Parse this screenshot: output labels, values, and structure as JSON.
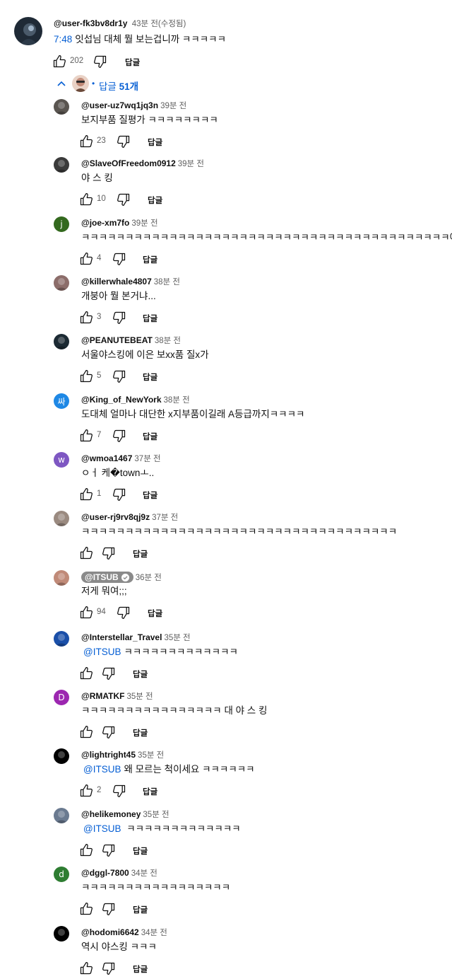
{
  "top_comment": {
    "author": "@user-fk3bv8dr1y",
    "time": "43분 전(수정됨)",
    "timestamp_link": "7:48",
    "text": "잇섭님 대체 뭘 보는겁니까 ㅋㅋㅋㅋㅋ",
    "likes": "202",
    "reply_label": "답글"
  },
  "replies_toggle": {
    "dot": "•",
    "label": "답글",
    "count": "51개"
  },
  "replies": [
    {
      "author": "@user-uz7wq1jq3n",
      "time": "39분 전",
      "mention": "",
      "text": "보지부품 질평가 ㅋㅋㅋㅋㅋㅋㅋㅋ",
      "likes": "23",
      "reply_label": "답글",
      "avatar": {
        "kind": "photo",
        "color": "#5a5550"
      }
    },
    {
      "author": "@SlaveOfFreedom0912",
      "time": "39분 전",
      "mention": "",
      "text": "야 스 킹",
      "likes": "10",
      "reply_label": "답글",
      "avatar": {
        "kind": "photo",
        "color": "#3a3a3a"
      }
    },
    {
      "author": "@joe-xm7fo",
      "time": "39분 전",
      "mention": "",
      "text": "ㅋㅋㅋㅋㅋㅋㅋㅋㅋㅋㅋㅋㅋㅋㅋㅋㅋㅋㅋㅋㅋㅋㅋㅋㅋㅋㅋㅋㅋㅋㅋㅋㅋㅋㅋㅋㅋㅋㅋㅋㅋㅋ아이",
      "likes": "4",
      "reply_label": "답글",
      "avatar": {
        "kind": "letter",
        "letter": "j",
        "color": "#33691e"
      }
    },
    {
      "author": "@killerwhale4807",
      "time": "38분 전",
      "mention": "",
      "text": "개붕아 뭘 본거냐...",
      "likes": "3",
      "reply_label": "답글",
      "avatar": {
        "kind": "photo",
        "color": "#8c6d6a"
      }
    },
    {
      "author": "@PEANUTEBEAT",
      "time": "38분 전",
      "mention": "",
      "text": "서울야스킹에 이은 보xx품 질x가",
      "likes": "5",
      "reply_label": "답글",
      "avatar": {
        "kind": "photo",
        "color": "#1c2a33"
      }
    },
    {
      "author": "@King_of_NewYork",
      "time": "38분 전",
      "mention": "",
      "text": "도대체 얼마나 대단한 x지부품이길래 A등급까지ㅋㅋㅋㅋ",
      "likes": "7",
      "reply_label": "답글",
      "avatar": {
        "kind": "letter",
        "letter": "싸",
        "color": "#1e88e5"
      }
    },
    {
      "author": "@wmoa1467",
      "time": "37분 전",
      "mention": "",
      "text": "ㅇㅓ 케�townㅗ..",
      "likes": "1",
      "reply_label": "답글",
      "avatar": {
        "kind": "letter",
        "letter": "w",
        "color": "#7e57c2"
      }
    },
    {
      "author": "@user-rj9rv8qj9z",
      "time": "37분 전",
      "mention": "",
      "text": "ㅋㅋㅋㅋㅋㅋㅋㅋㅋㅋㅋㅋㅋㅋㅋㅋㅋㅋㅋㅋㅋㅋㅋㅋㅋㅋㅋㅋㅋㅋㅋㅋㅋㅋㅋㅋ",
      "likes": "",
      "reply_label": "답글",
      "avatar": {
        "kind": "photo",
        "color": "#9a8a80"
      }
    },
    {
      "author": "@ITSUB",
      "time": "36분 전",
      "owner": true,
      "mention": "",
      "text": "저게 뭐여;;;",
      "likes": "94",
      "reply_label": "답글",
      "avatar": {
        "kind": "photo",
        "color": "#c08a78"
      }
    },
    {
      "author": "@Interstellar_Travel",
      "time": "35분 전",
      "mention": "@ITSUB",
      "text": "ㅋㅋㅋㅋㅋㅋㅋㅋㅋㅋㅋㅋㅋ",
      "likes": "",
      "reply_label": "답글",
      "avatar": {
        "kind": "photo",
        "color": "#1a4fa8"
      }
    },
    {
      "author": "@RMATKF",
      "time": "35분 전",
      "mention": "",
      "text": "ㅋㅋㅋㅋㅋㅋㅋㅋㅋㅋㅋㅋㅋㅋㅋㅋ 대 야 스 킹",
      "likes": "",
      "reply_label": "답글",
      "avatar": {
        "kind": "letter",
        "letter": "D",
        "color": "#9c27b0"
      }
    },
    {
      "author": "@lightright45",
      "time": "35분 전",
      "mention": "@ITSUB",
      "text": "왜 모르는 척이세요 ㅋㅋㅋㅋㅋㅋ",
      "likes": "2",
      "reply_label": "답글",
      "avatar": {
        "kind": "photo",
        "color": "#000000"
      }
    },
    {
      "author": "@helikemoney",
      "time": "35분 전",
      "mention": "@ITSUB",
      "text": " ㅋㅋㅋㅋㅋㅋㅋㅋㅋㅋㅋㅋㅋ",
      "likes": "",
      "reply_label": "답글",
      "avatar": {
        "kind": "photo",
        "color": "#6a7a90"
      }
    },
    {
      "author": "@dggl-7800",
      "time": "34분 전",
      "mention": "",
      "text": "ㅋㅋㅋㅋㅋㅋㅋㅋㅋㅋㅋㅋㅋㅋㅋㅋㅋ",
      "likes": "",
      "reply_label": "답글",
      "avatar": {
        "kind": "letter",
        "letter": "d",
        "color": "#2e7d32"
      }
    },
    {
      "author": "@hodomi6642",
      "time": "34분 전",
      "mention": "",
      "text": "역시 야스킹 ㅋㅋㅋ",
      "likes": "",
      "reply_label": "답글",
      "avatar": {
        "kind": "photo",
        "color": "#000000"
      }
    }
  ],
  "colors": {
    "link": "#065fd4",
    "meta": "#606060",
    "text": "#0f0f0f",
    "owner_badge": "#8a8a8a"
  },
  "icons": {
    "like": "thumb-up-icon",
    "dislike": "thumb-down-icon",
    "collapse": "chevron-up-icon",
    "verified": "check-circle-icon"
  }
}
